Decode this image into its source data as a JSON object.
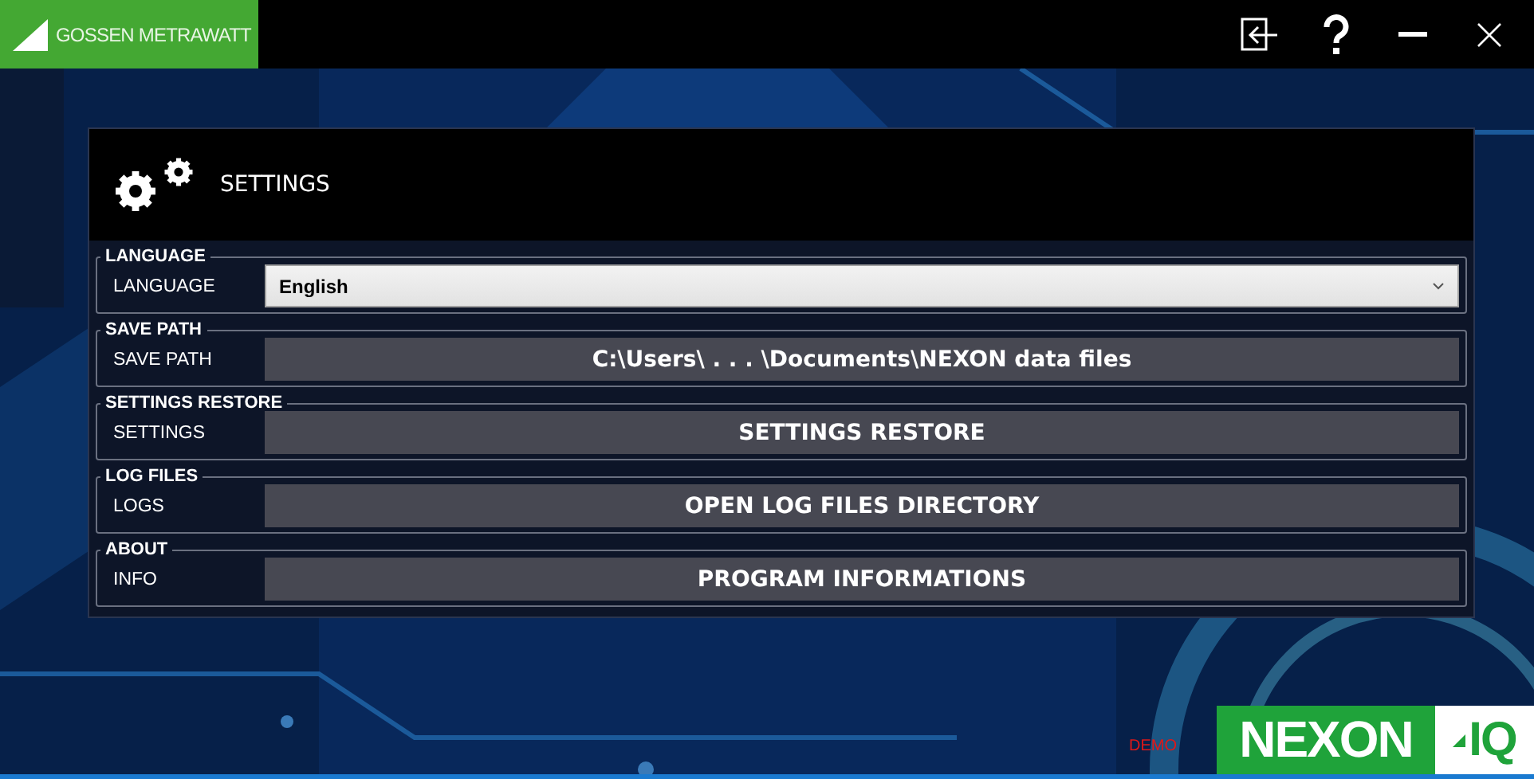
{
  "window": {
    "brand": "GOSSEN METRAWATT"
  },
  "panel": {
    "title": "SETTINGS"
  },
  "groups": [
    {
      "heading": "LANGUAGE",
      "label": "LANGUAGE",
      "kind": "select",
      "value": "English"
    },
    {
      "heading": "SAVE PATH",
      "label": "SAVE PATH",
      "kind": "button",
      "value": "C:\\Users\\ . . . \\Documents\\NEXON data files"
    },
    {
      "heading": "SETTINGS RESTORE",
      "label": "SETTINGS",
      "kind": "button",
      "value": "SETTINGS RESTORE"
    },
    {
      "heading": "LOG FILES",
      "label": "LOGS",
      "kind": "button",
      "value": "OPEN LOG FILES DIRECTORY"
    },
    {
      "heading": "ABOUT",
      "label": "INFO",
      "kind": "button",
      "value": "PROGRAM INFORMATIONS"
    }
  ],
  "demo": "DEMO",
  "logo": {
    "name": "NEXON",
    "suffix": "IQ"
  }
}
